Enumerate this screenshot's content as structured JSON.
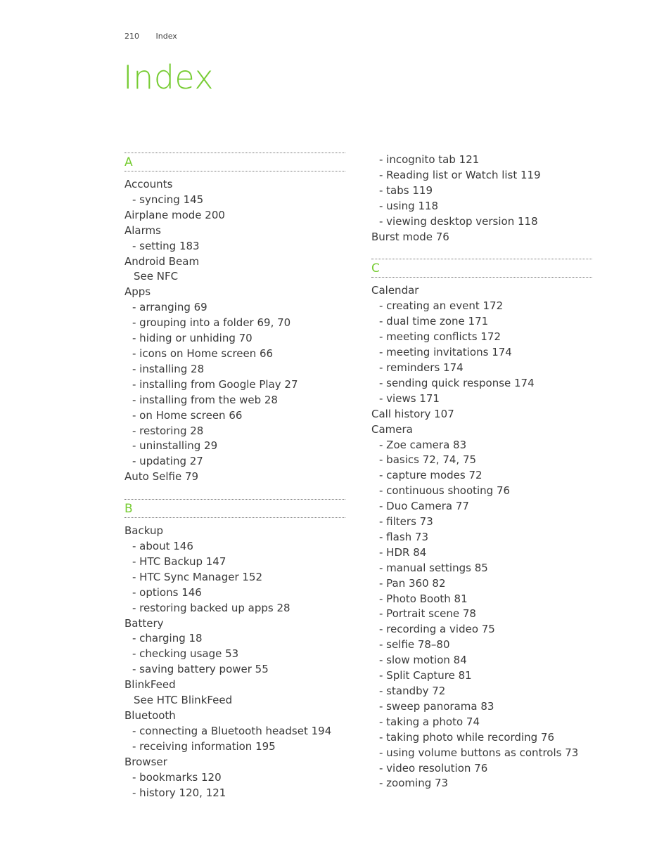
{
  "header": {
    "page_number": "210",
    "section": "Index"
  },
  "title": "Index",
  "accent_color": "#77cc33",
  "left_column": [
    {
      "type": "section",
      "letter": "A"
    },
    {
      "type": "main",
      "text": "Accounts"
    },
    {
      "type": "sub",
      "text": "- syncing  145"
    },
    {
      "type": "main",
      "text": "Airplane mode  200"
    },
    {
      "type": "main",
      "text": "Alarms"
    },
    {
      "type": "sub",
      "text": "- setting  183"
    },
    {
      "type": "main",
      "text": "Android Beam"
    },
    {
      "type": "see",
      "text": "See NFC"
    },
    {
      "type": "main",
      "text": "Apps"
    },
    {
      "type": "sub",
      "text": "- arranging  69"
    },
    {
      "type": "sub",
      "text": "- grouping into a folder  69, 70"
    },
    {
      "type": "sub",
      "text": "- hiding or unhiding  70"
    },
    {
      "type": "sub",
      "text": "- icons on Home screen  66"
    },
    {
      "type": "sub",
      "text": "- installing  28"
    },
    {
      "type": "sub",
      "text": "- installing from Google Play  27"
    },
    {
      "type": "sub",
      "text": "- installing from the web  28"
    },
    {
      "type": "sub",
      "text": "- on Home screen  66"
    },
    {
      "type": "sub",
      "text": "- restoring  28"
    },
    {
      "type": "sub",
      "text": "- uninstalling  29"
    },
    {
      "type": "sub",
      "text": "- updating  27"
    },
    {
      "type": "main",
      "text": "Auto Selfie  79"
    },
    {
      "type": "spacer"
    },
    {
      "type": "section",
      "letter": "B"
    },
    {
      "type": "main",
      "text": "Backup"
    },
    {
      "type": "sub",
      "text": "- about  146"
    },
    {
      "type": "sub",
      "text": "- HTC Backup  147"
    },
    {
      "type": "sub",
      "text": "- HTC Sync Manager  152"
    },
    {
      "type": "sub",
      "text": "- options  146"
    },
    {
      "type": "sub",
      "text": "- restoring backed up apps  28"
    },
    {
      "type": "main",
      "text": "Battery"
    },
    {
      "type": "sub",
      "text": "- charging  18"
    },
    {
      "type": "sub",
      "text": "- checking usage  53"
    },
    {
      "type": "sub",
      "text": "- saving battery power  55"
    },
    {
      "type": "main",
      "text": "BlinkFeed"
    },
    {
      "type": "see",
      "text": "See HTC BlinkFeed"
    },
    {
      "type": "main",
      "text": "Bluetooth"
    },
    {
      "type": "sub",
      "text": "- connecting a Bluetooth headset  194"
    },
    {
      "type": "sub",
      "text": "- receiving information  195"
    },
    {
      "type": "main",
      "text": "Browser"
    },
    {
      "type": "sub",
      "text": "- bookmarks  120"
    },
    {
      "type": "sub",
      "text": "- history  120, 121"
    }
  ],
  "right_column": [
    {
      "type": "sub",
      "text": "- incognito tab  121"
    },
    {
      "type": "sub",
      "text": "- Reading list or Watch list  119"
    },
    {
      "type": "sub",
      "text": "- tabs  119"
    },
    {
      "type": "sub",
      "text": "- using  118"
    },
    {
      "type": "sub",
      "text": "- viewing desktop version  118"
    },
    {
      "type": "main",
      "text": "Burst mode  76"
    },
    {
      "type": "spacer"
    },
    {
      "type": "section",
      "letter": "C"
    },
    {
      "type": "main",
      "text": "Calendar"
    },
    {
      "type": "sub",
      "text": "- creating an event  172"
    },
    {
      "type": "sub",
      "text": "- dual time zone  171"
    },
    {
      "type": "sub",
      "text": "- meeting conflicts  172"
    },
    {
      "type": "sub",
      "text": "- meeting invitations  174"
    },
    {
      "type": "sub",
      "text": "- reminders  174"
    },
    {
      "type": "sub",
      "text": "- sending quick response  174"
    },
    {
      "type": "sub",
      "text": "- views  171"
    },
    {
      "type": "main",
      "text": "Call history  107"
    },
    {
      "type": "main",
      "text": "Camera"
    },
    {
      "type": "sub",
      "text": "- Zoe camera  83"
    },
    {
      "type": "sub",
      "text": "- basics  72, 74, 75"
    },
    {
      "type": "sub",
      "text": "- capture modes  72"
    },
    {
      "type": "sub",
      "text": "- continuous shooting  76"
    },
    {
      "type": "sub",
      "text": "- Duo Camera  77"
    },
    {
      "type": "sub",
      "text": "- filters  73"
    },
    {
      "type": "sub",
      "text": "- flash  73"
    },
    {
      "type": "sub",
      "text": "- HDR  84"
    },
    {
      "type": "sub",
      "text": "- manual settings  85"
    },
    {
      "type": "sub",
      "text": "- Pan 360  82"
    },
    {
      "type": "sub",
      "text": "- Photo Booth  81"
    },
    {
      "type": "sub",
      "text": "- Portrait scene  78"
    },
    {
      "type": "sub",
      "text": "- recording a video  75"
    },
    {
      "type": "sub",
      "text": "- selfie  78–80"
    },
    {
      "type": "sub",
      "text": "- slow motion  84"
    },
    {
      "type": "sub",
      "text": "- Split Capture  81"
    },
    {
      "type": "sub",
      "text": "- standby  72"
    },
    {
      "type": "sub",
      "text": "- sweep panorama  83"
    },
    {
      "type": "sub",
      "text": "- taking a photo  74"
    },
    {
      "type": "sub",
      "text": "- taking photo while recording  76"
    },
    {
      "type": "sub",
      "text": "- using volume buttons as controls  73"
    },
    {
      "type": "sub",
      "text": "- video resolution  76"
    },
    {
      "type": "sub",
      "text": "- zooming  73"
    }
  ]
}
